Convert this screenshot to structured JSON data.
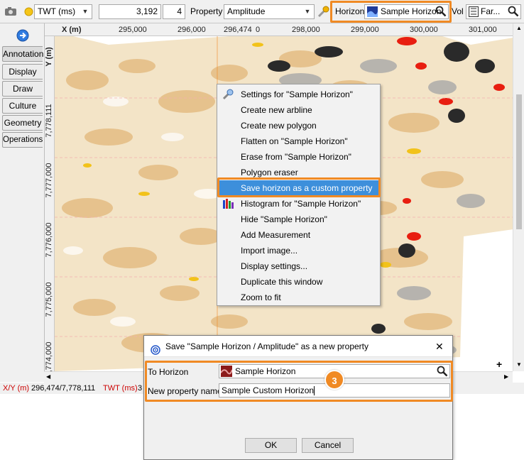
{
  "toolbar": {
    "domain_value": "TWT (ms)",
    "inline_value": "3,192",
    "step_value": "4",
    "property_label": "Property",
    "property_value": "Amplitude",
    "horizon_label": "Horizon",
    "horizon_value": "Sample Horizon",
    "vol_label": "Vol",
    "vol_value": "Far..."
  },
  "side_tabs": [
    "Annotation",
    "Display",
    "Draw",
    "Culture",
    "Geometry",
    "Operations"
  ],
  "ruler": {
    "x_label": "X (m)",
    "y_label": "Y (m)",
    "x_ticks": [
      "295,000",
      "296,000",
      "296,474",
      "298,000",
      "299,000",
      "300,000",
      "301,000"
    ],
    "x_ticks_partial": [
      "0"
    ],
    "y_ticks": [
      "7,778,111",
      "7,777,000",
      "7,776,000",
      "7,775,000",
      "7,774,000"
    ]
  },
  "status": {
    "xy_label": "X/Y (m)",
    "xy_value": "296,474/7,778,111",
    "twt_label": "TWT (ms)",
    "twt_value": "3"
  },
  "context_menu": {
    "items": [
      "Settings for \"Sample Horizon\"",
      "Create new arbline",
      "Create new polygon",
      "Flatten on \"Sample Horizon\"",
      "Erase from \"Sample Horizon\"",
      "Polygon eraser",
      "Save horizon as a custom property",
      "Histogram for \"Sample Horizon\"",
      "Hide \"Sample Horizon\"",
      "Add Measurement",
      "Import image...",
      "Display settings...",
      "Duplicate this window",
      "Zoom to fit"
    ],
    "highlighted_index": 6
  },
  "dialog": {
    "title": "Save \"Sample Horizon / Amplitude\" as a new property",
    "to_horizon_label": "To Horizon",
    "to_horizon_value": "Sample Horizon",
    "new_property_label": "New property name",
    "new_property_value": "Sample Custom Horizon",
    "ok_label": "OK",
    "cancel_label": "Cancel",
    "close_glyph": "✕"
  },
  "callout": {
    "number": "3"
  },
  "colors": {
    "highlight_box": "#f08a24",
    "menu_highlight": "#3d8fdb",
    "status_label": "#cc0000"
  }
}
